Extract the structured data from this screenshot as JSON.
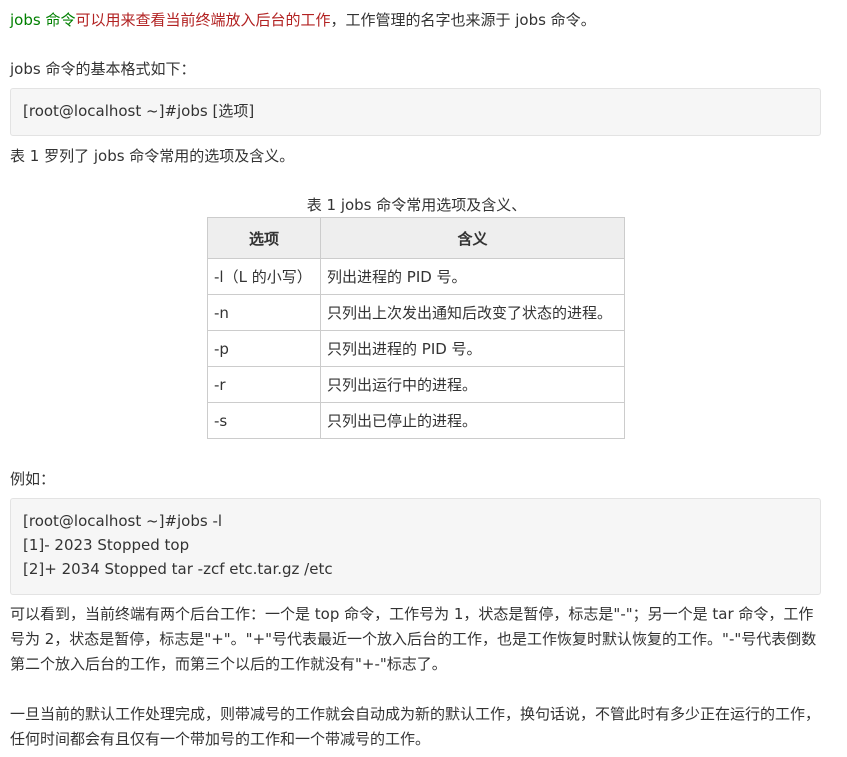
{
  "intro": {
    "term": "jobs 命令",
    "highlight": "可以用来查看当前终端放入后台的工作",
    "rest": "，工作管理的名字也来源于 jobs 命令。"
  },
  "format_label": "jobs 命令的基本格式如下：",
  "format_code": "[root@localhost ~]#jobs [选项]",
  "table_intro": "表 1 罗列了 jobs 命令常用的选项及含义。",
  "table": {
    "caption": "表 1 jobs 命令常用选项及含义、",
    "headers": [
      "选项",
      "含义"
    ],
    "rows": [
      [
        "-l（L 的小写）",
        "列出进程的 PID 号。"
      ],
      [
        "-n",
        "只列出上次发出通知后改变了状态的进程。"
      ],
      [
        "-p",
        "只列出进程的 PID 号。"
      ],
      [
        "-r",
        "只列出运行中的进程。"
      ],
      [
        "-s",
        "只列出已停止的进程。"
      ]
    ]
  },
  "example_label": "例如：",
  "example_code": [
    "[root@localhost ~]#jobs -l",
    "[1]- 2023 Stopped top",
    "[2]+ 2034 Stopped tar -zcf etc.tar.gz /etc"
  ],
  "paragraph1": "可以看到，当前终端有两个后台工作：一个是 top 命令，工作号为 1，状态是暂停，标志是\"-\"；另一个是 tar 命令，工作号为 2，状态是暂停，标志是\"+\"。\"+\"号代表最近一个放入后台的工作，也是工作恢复时默认恢复的工作。\"-\"号代表倒数第二个放入后台的工作，而第三个以后的工作就没有\"+-\"标志了。",
  "paragraph2": "一旦当前的默认工作处理完成，则带减号的工作就会自动成为新的默认工作，换句话说，不管此时有多少正在运行的工作，任何时间都会有且仅有一个带加号的工作和一个带减号的工作。"
}
